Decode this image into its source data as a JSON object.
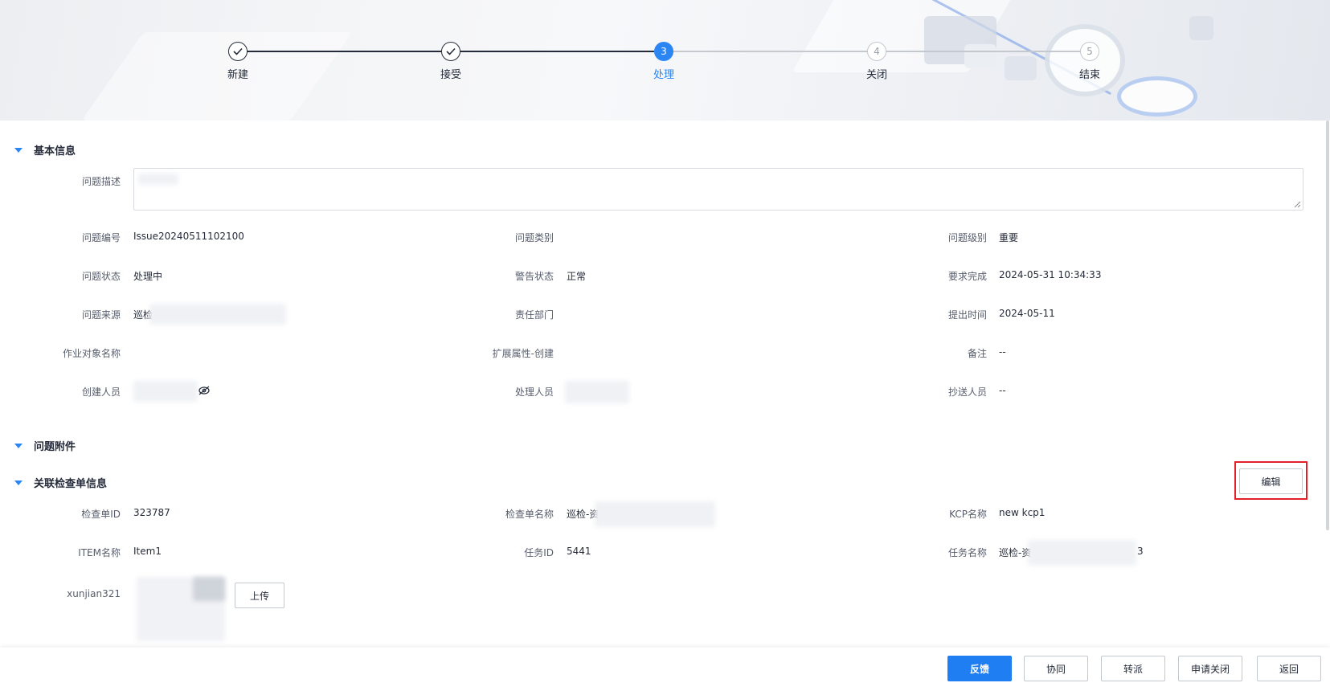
{
  "steps": [
    {
      "label": "新建",
      "state": "done"
    },
    {
      "label": "接受",
      "state": "done"
    },
    {
      "label": "处理",
      "state": "active",
      "number": "3"
    },
    {
      "label": "关闭",
      "state": "todo",
      "number": "4"
    },
    {
      "label": "结束",
      "state": "todo",
      "number": "5"
    }
  ],
  "sections": {
    "basic": "基本信息",
    "attachments": "问题附件",
    "checklist": "关联检查单信息"
  },
  "basic": {
    "desc_label": "问题描述",
    "issue_no_label": "问题编号",
    "issue_no": "Issue20240511102100",
    "issue_type_label": "问题类别",
    "issue_level_label": "问题级别",
    "issue_level": "重要",
    "status_label": "问题状态",
    "status": "处理中",
    "alarm_label": "警告状态",
    "alarm": "正常",
    "deadline_label": "要求完成",
    "deadline": "2024-05-31 10:34:33",
    "source_label": "问题来源",
    "source": "巡检",
    "dept_label": "责任部门",
    "submit_time_label": "提出时间",
    "submit_time": "2024-05-11",
    "target_label": "作业对象名称",
    "ext_label": "扩展属性-创建",
    "remark_label": "备注",
    "remark": "--",
    "creator_label": "创建人员",
    "handler_label": "处理人员",
    "cc_label": "抄送人员",
    "cc": "--"
  },
  "checklist": {
    "edit_label": "编辑",
    "check_id_label": "检查单ID",
    "check_id": "323787",
    "check_name_label": "检查单名称",
    "check_name": "巡检-资",
    "kcp_label": "KCP名称",
    "kcp": "new kcp1",
    "item_label": "ITEM名称",
    "item": "Item1",
    "task_id_label": "任务ID",
    "task_id": "5441",
    "task_name_label": "任务名称",
    "task_name_prefix": "巡检-资",
    "task_name_suffix": "3",
    "xunjian_label": "xunjian321",
    "upload_label": "上传"
  },
  "footer": {
    "feedback": "反馈",
    "collab": "协同",
    "transfer": "转派",
    "apply_close": "申请关闭",
    "back": "返回"
  },
  "colors": {
    "accent": "#1f7ef2",
    "highlight": "#e3202a"
  }
}
